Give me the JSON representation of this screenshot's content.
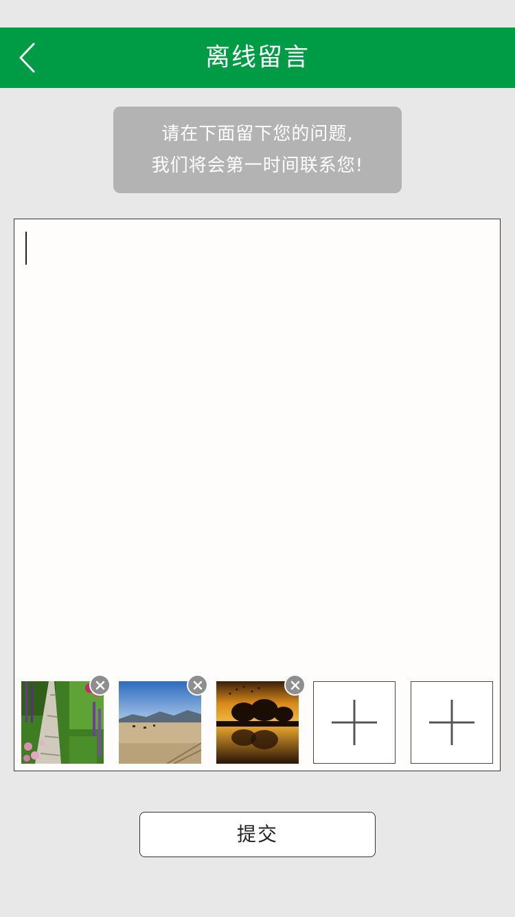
{
  "nav": {
    "title": "离线留言",
    "back_icon": "chevron-left-icon",
    "background": "#009b45"
  },
  "tip": {
    "line1": "请在下面留下您的问题,",
    "line2": "我们将会第一时间联系您!"
  },
  "message": {
    "value": ""
  },
  "attachments": {
    "photos": [
      {
        "name": "garden-path-photo",
        "remove_icon": "close-icon"
      },
      {
        "name": "plains-mountains-photo",
        "remove_icon": "close-icon"
      },
      {
        "name": "sunset-lake-photo",
        "remove_icon": "close-icon"
      }
    ],
    "add_slots": [
      {
        "icon": "plus-icon"
      },
      {
        "icon": "plus-icon"
      }
    ]
  },
  "submit": {
    "label": "提交"
  }
}
